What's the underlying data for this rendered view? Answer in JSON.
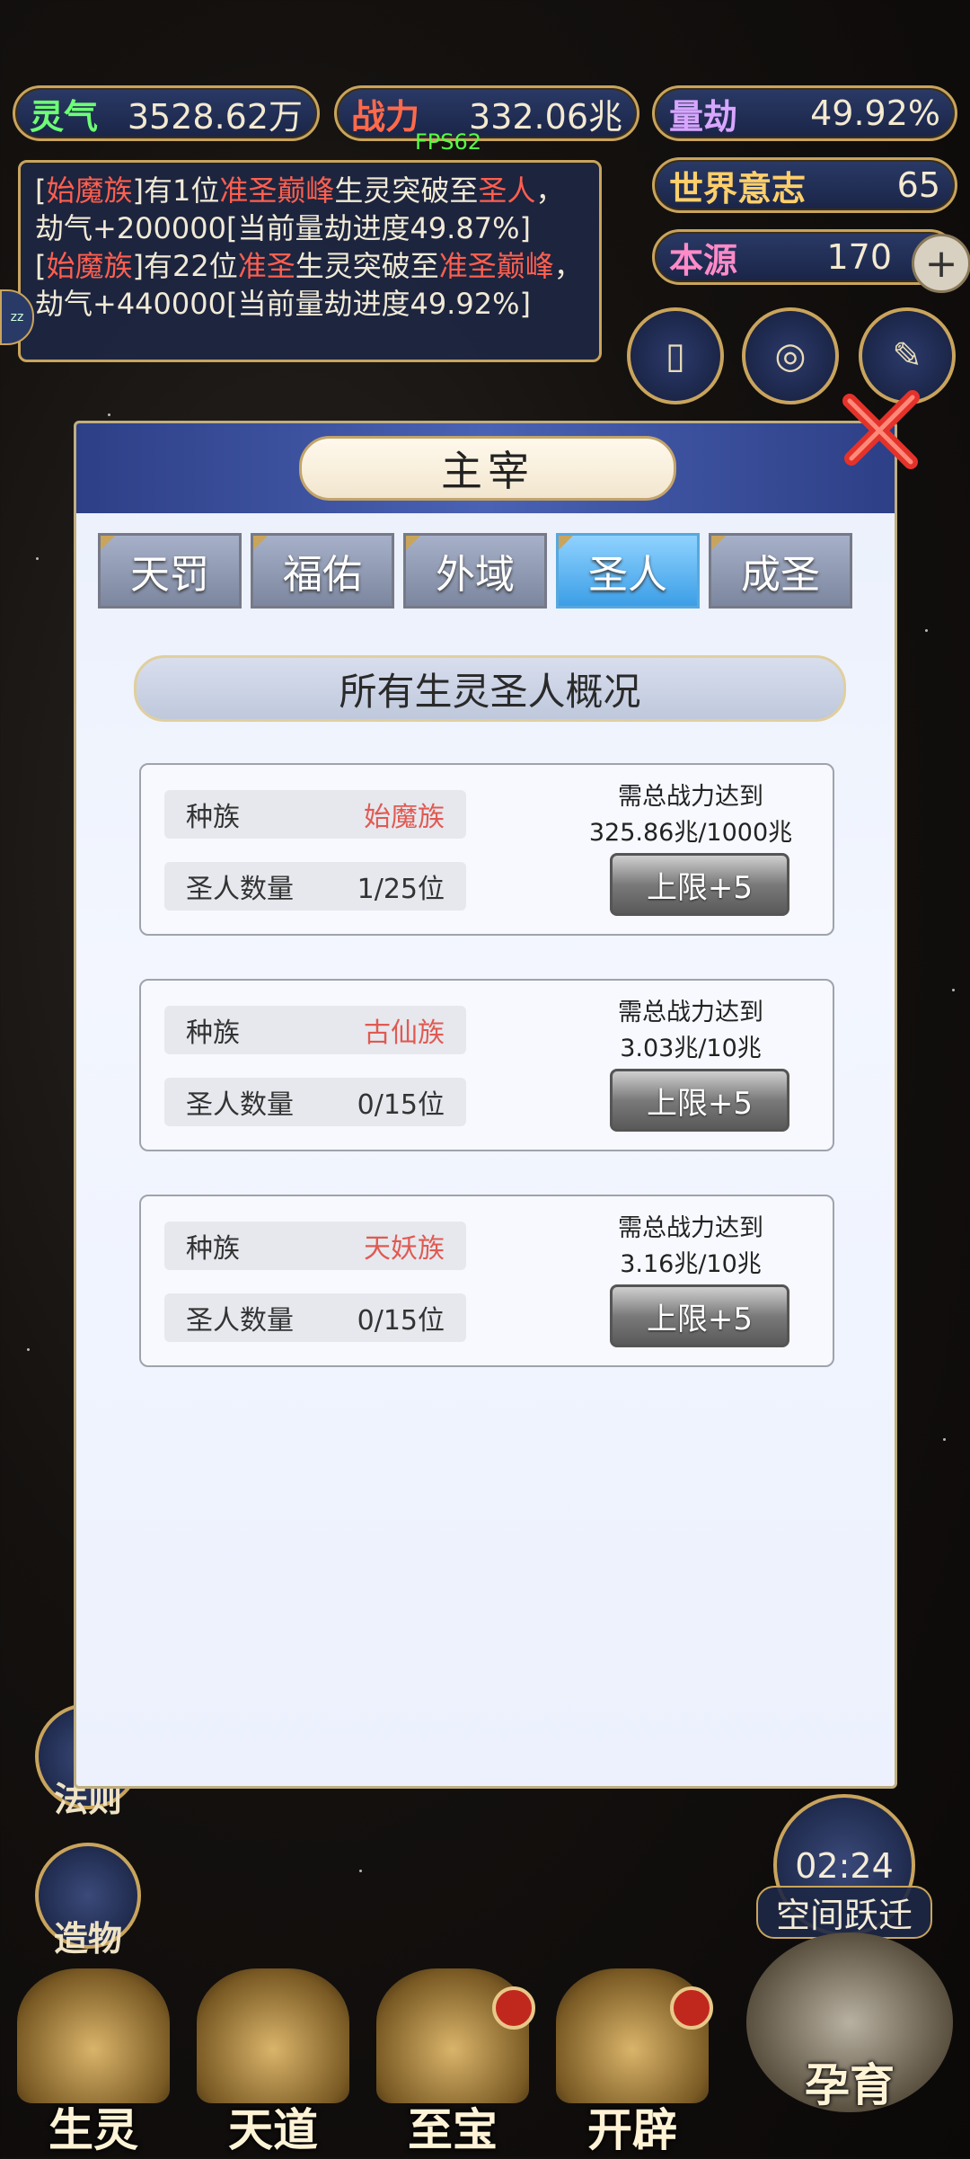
{
  "top_stats": {
    "lingqi": {
      "label": "灵气",
      "value": "3528.62万"
    },
    "zhanli": {
      "label": "战力",
      "value": "332.06兆"
    },
    "liangjie": {
      "label": "量劫",
      "value": "49.92%"
    },
    "shijie": {
      "label": "世界意志",
      "value": "65"
    },
    "benyuan": {
      "label": "本源",
      "value": "170"
    }
  },
  "fps": "FPS62",
  "log": {
    "line1": {
      "a": "[",
      "race": "始魔族",
      "b": "]有1位",
      "rank": "准圣巅峰",
      "c": "生灵突破至",
      "target": "圣人",
      "d": "，劫气+200000[当前量劫进度49.87%]"
    },
    "line2": {
      "a": "[",
      "race": "始魔族",
      "b": "]有22位",
      "rank": "准圣",
      "c": "生灵突破至",
      "target": "准圣巅峰",
      "d": "，劫气+440000[当前量劫进度49.92%]"
    }
  },
  "left_menu": [
    "法则",
    "造物"
  ],
  "bottom_nav": [
    "生灵",
    "天道",
    "至宝",
    "开辟",
    "孕育"
  ],
  "event": {
    "timer": "02:24",
    "label": "空间跃迁"
  },
  "modal": {
    "title": "主宰",
    "tabs": [
      "天罚",
      "福佑",
      "外域",
      "圣人",
      "成圣"
    ],
    "active_tab": "圣人",
    "section_title": "所有生灵圣人概况",
    "cards": [
      {
        "race_label": "种族",
        "race": "始魔族",
        "count_label": "圣人数量",
        "count": "1/25位",
        "req_label": "需总战力达到",
        "req_value": "325.86兆/1000兆",
        "button": "上限+5"
      },
      {
        "race_label": "种族",
        "race": "古仙族",
        "count_label": "圣人数量",
        "count": "0/15位",
        "req_label": "需总战力达到",
        "req_value": "3.03兆/10兆",
        "button": "上限+5"
      },
      {
        "race_label": "种族",
        "race": "天妖族",
        "count_label": "圣人数量",
        "count": "0/15位",
        "req_label": "需总战力达到",
        "req_value": "3.16兆/10兆",
        "button": "上限+5"
      }
    ]
  },
  "colors": {
    "accent_gold": "#c9a45c",
    "race_red": "#e05a52",
    "tab_active": "#3c9ee6"
  }
}
